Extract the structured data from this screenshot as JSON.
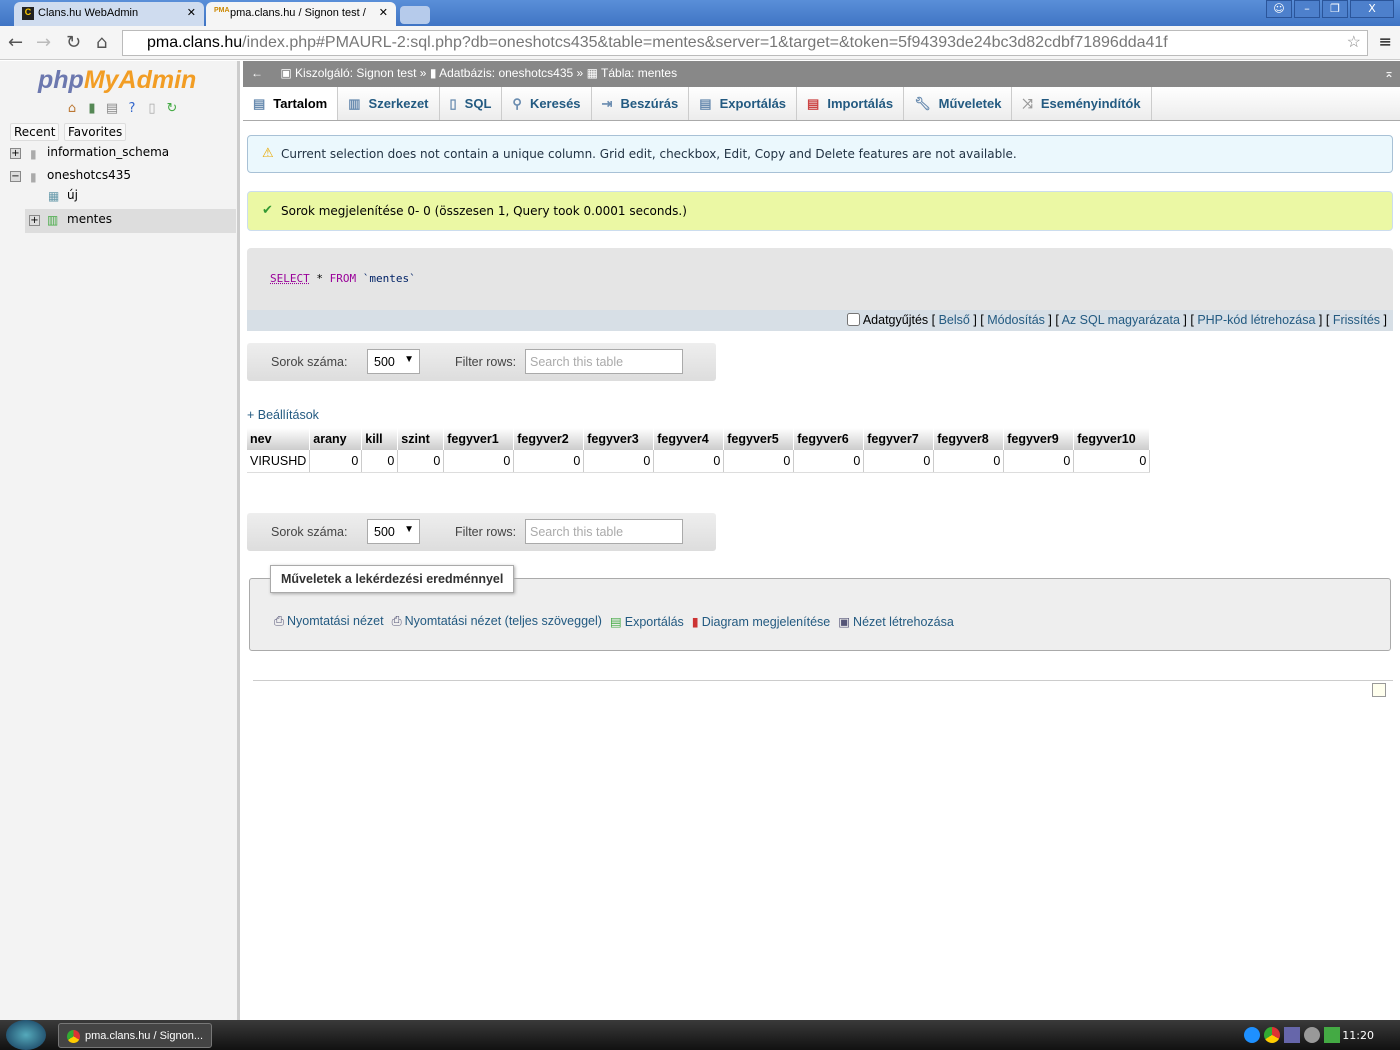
{
  "browser": {
    "tabs": [
      {
        "title": "Clans.hu WebAdmin",
        "icon": "C"
      },
      {
        "title": "pma.clans.hu / Signon test /",
        "icon": "PMA"
      }
    ],
    "url_host": "pma.clans.hu",
    "url_path": "/index.php#PMAURL-2:sql.php?db=oneshotcs435&table=mentes&server=1&target=&token=5f94393de24bc3d82cdbf71896dda41f"
  },
  "sidebar": {
    "logo_php": "php",
    "logo_myadmin": "MyAdmin",
    "recent": "Recent",
    "favorites": "Favorites",
    "tree": [
      {
        "label": "information_schema"
      },
      {
        "label": "oneshotcs435"
      },
      {
        "label": "új"
      },
      {
        "label": "mentes"
      }
    ]
  },
  "breadcrumb": {
    "server": "Kiszolgáló: Signon test",
    "sep": "»",
    "database": "Adatbázis: oneshotcs435",
    "table": "Tábla: mentes"
  },
  "tabs": [
    {
      "label": "Tartalom",
      "active": true
    },
    {
      "label": "Szerkezet"
    },
    {
      "label": "SQL"
    },
    {
      "label": "Keresés"
    },
    {
      "label": "Beszúrás"
    },
    {
      "label": "Exportálás"
    },
    {
      "label": "Importálás"
    },
    {
      "label": "Műveletek"
    },
    {
      "label": "Eseményindítók"
    }
  ],
  "notice": "Current selection does not contain a unique column. Grid edit, checkbox, Edit, Copy and Delete features are not available.",
  "success": "Sorok megjelenítése 0- 0 (összesen 1, Query took 0.0001 seconds.)",
  "sql": {
    "select": "SELECT",
    "star": " * ",
    "from": "FROM",
    "table": " `mentes`"
  },
  "sql_links": {
    "profiling": "Adatgyűjtés",
    "inline": "Belső",
    "edit": "Módosítás",
    "explain": "Az SQL magyarázata",
    "php": "PHP-kód létrehozása",
    "refresh": "Frissítés"
  },
  "nav": {
    "rows_label": "Sorok száma:",
    "rows_value": "500",
    "filter_label": "Filter rows:",
    "filter_placeholder": "Search this table"
  },
  "settings": "+ Beállítások",
  "table": {
    "columns": [
      "nev",
      "arany",
      "kill",
      "szint",
      "fegyver1",
      "fegyver2",
      "fegyver3",
      "fegyver4",
      "fegyver5",
      "fegyver6",
      "fegyver7",
      "fegyver8",
      "fegyver9",
      "fegyver10"
    ],
    "rows": [
      [
        "VIRUSHD",
        "0",
        "0",
        "0",
        "0",
        "0",
        "0",
        "0",
        "0",
        "0",
        "0",
        "0",
        "0",
        "0"
      ]
    ]
  },
  "ops": {
    "legend": "Műveletek a lekérdezési eredménnyel",
    "links": [
      "Nyomtatási nézet",
      "Nyomtatási nézet (teljes szöveggel)",
      "Exportálás",
      "Diagram megjelenítése",
      "Nézet létrehozása"
    ]
  },
  "taskbar": {
    "task": "pma.clans.hu / Signon...",
    "clock": "11:20"
  }
}
